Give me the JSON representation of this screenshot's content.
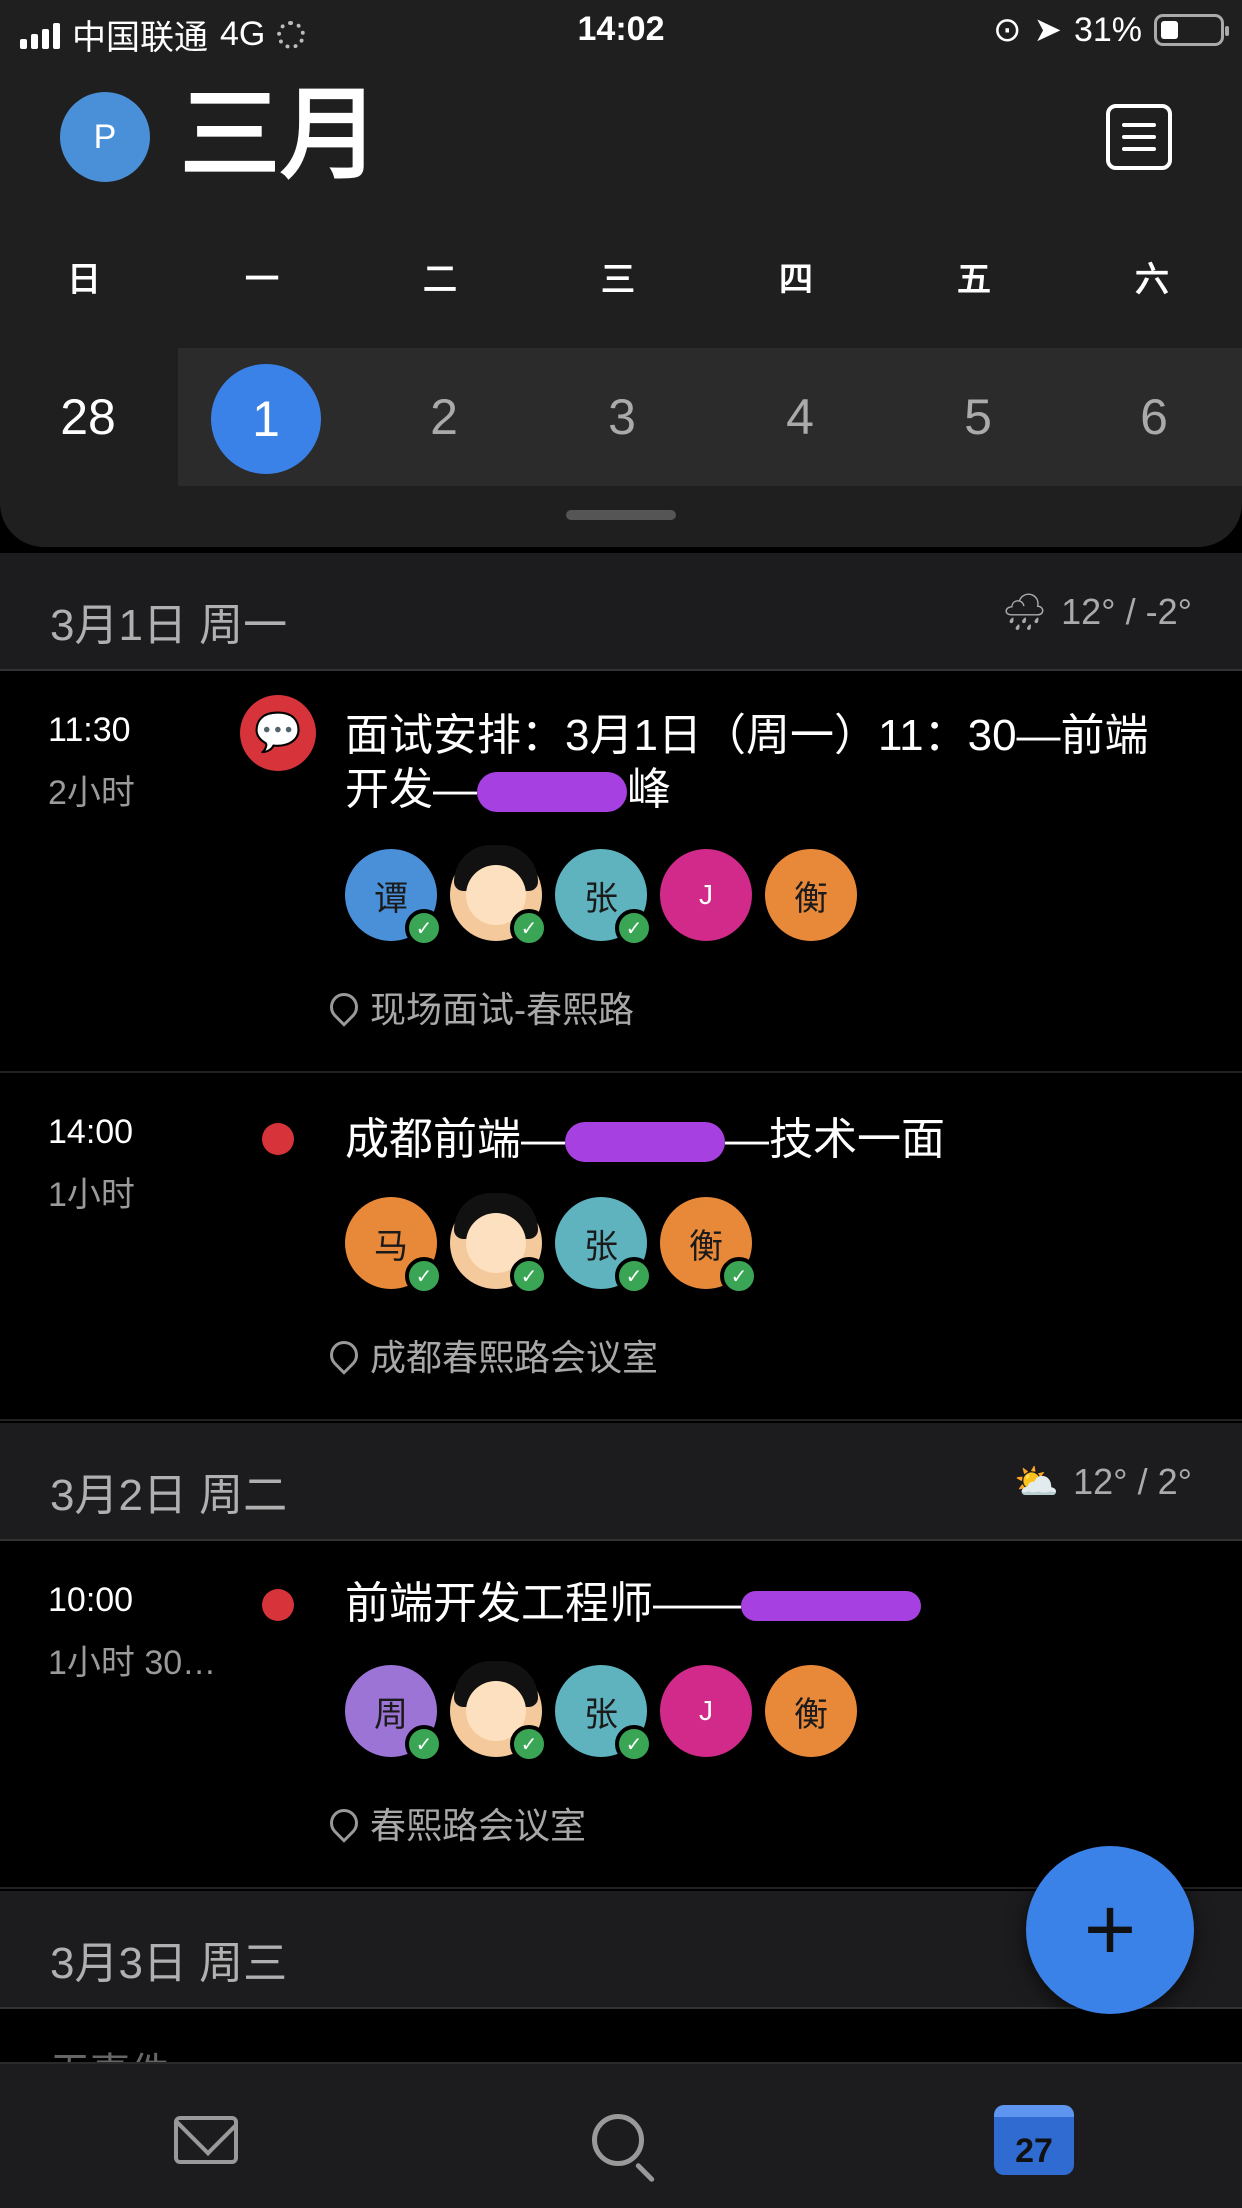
{
  "status": {
    "carrier": "中国联通",
    "network": "4G",
    "time": "14:02",
    "battery_pct": "31%",
    "battery_level": 0.31
  },
  "header": {
    "avatar_initial": "P",
    "month": "三月",
    "weekdays": [
      "日",
      "一",
      "二",
      "三",
      "四",
      "五",
      "六"
    ],
    "dates": [
      "28",
      "1",
      "2",
      "3",
      "4",
      "5",
      "6"
    ],
    "selected_date": "1"
  },
  "days": [
    {
      "label": "3月1日 周一",
      "weather_icon": "rain-cloud-icon",
      "weather": "12° / -2°"
    },
    {
      "label": "3月2日 周二",
      "weather_icon": "partly-sunny-icon",
      "weather": "12° / 2°"
    },
    {
      "label": "3月3日 周三"
    }
  ],
  "events": [
    {
      "time": "11:30",
      "duration": "2小时",
      "title": "面试安排：3月1日（周一）11：30—前端开发—",
      "title_tail": "峰",
      "attendees": [
        "谭",
        "张",
        "J",
        "衡"
      ],
      "location": "现场面试-春熙路"
    },
    {
      "time": "14:00",
      "duration": "1小时",
      "title_pre": "成都前端—",
      "title_post": "—技术一面",
      "attendees": [
        "马",
        "张",
        "衡"
      ],
      "location": "成都春熙路会议室"
    },
    {
      "time": "10:00",
      "duration": "1小时 30…",
      "title": "前端开发工程师——",
      "attendees": [
        "周",
        "张",
        "J",
        "衡"
      ],
      "location": "春熙路会议室"
    }
  ],
  "peek_text": "无事件",
  "fab_label": "+",
  "tabbar": {
    "calendar_badge": "27"
  },
  "colors": {
    "accent": "#3b82e8",
    "event_red": "#d6343a",
    "check_green": "#3aa655",
    "attendee_blue": "#4a90d9",
    "attendee_teal": "#5fb3bf",
    "attendee_pink": "#d12a8a",
    "attendee_orange": "#e8893a",
    "attendee_purple": "#9b74d6",
    "redaction": "#a740e0"
  }
}
